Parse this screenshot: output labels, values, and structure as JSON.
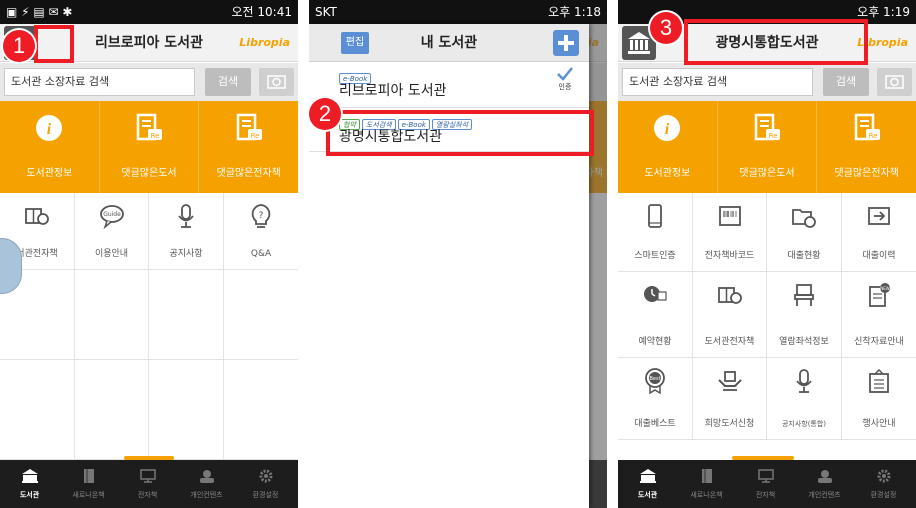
{
  "phone1": {
    "status_time": "오전 10:41",
    "title": "리브로피아 도서관",
    "brand": "Libropia",
    "search_placeholder": "도서관 소장자료 검색",
    "search_button": "검색",
    "orange_menu": [
      "도서관정보",
      "댓글많은도서",
      "댓글많은전자책"
    ],
    "grid": [
      "서관전자책",
      "이용안내",
      "공지사항",
      "Q&A"
    ],
    "badge": "1"
  },
  "phone2": {
    "status_carrier": "SKT",
    "status_time": "오후 1:18",
    "edit_button": "편집",
    "title": "내 도서관",
    "brand_partial": "opia",
    "libraries": [
      {
        "tags": [
          "e-Book"
        ],
        "name": "리브로피아 도서관",
        "status": "인증"
      },
      {
        "tags": [
          "협약",
          "도서검색",
          "e-Book",
          "열람실좌석"
        ],
        "name": "광명시통합도서관"
      }
    ],
    "bg_partial_labels": [
      "자책"
    ],
    "badge": "2"
  },
  "phone3": {
    "status_time": "오후 1:19",
    "title": "광명시통합도서관",
    "brand": "Libropia",
    "search_placeholder": "도서관 소장자료 검색",
    "search_button": "검색",
    "orange_menu": [
      "도서관정보",
      "댓글많은도서",
      "댓글많은전자책"
    ],
    "grid": [
      "스마트인증",
      "전자책바코드",
      "대출현황",
      "대출이력",
      "예약현황",
      "도서관전자책",
      "열람좌석정보",
      "신착자료안내",
      "대출베스트",
      "희망도서신청",
      "공지사항(통합)",
      "행사안내"
    ],
    "badge": "3"
  },
  "navbar": [
    "도서관",
    "새로나온책",
    "전자책",
    "개인컨텐츠",
    "환경설정"
  ],
  "colors": {
    "accent": "#f5a200",
    "highlight": "#ee1c24",
    "blue": "#5a8fd6"
  }
}
